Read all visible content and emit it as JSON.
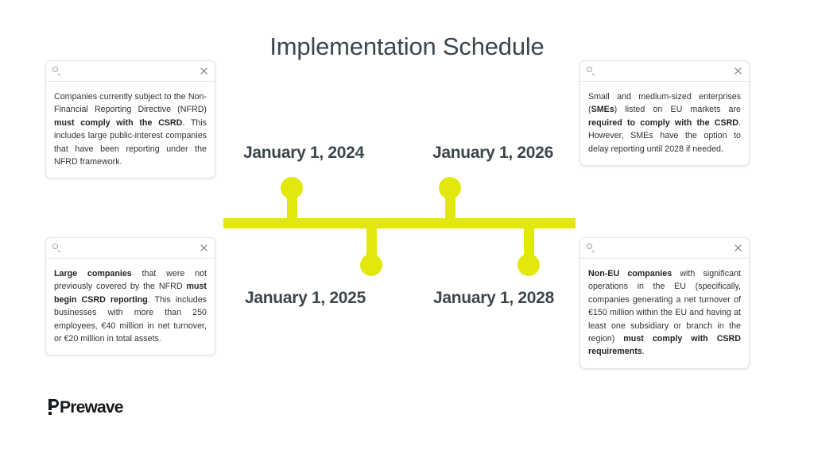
{
  "slide": {
    "title": "Implementation Schedule",
    "accent_color": "#e2e80c",
    "text_color": "#3d464c",
    "background": "#ffffff"
  },
  "timeline": {
    "milestones": [
      {
        "id": "m2024",
        "date": "January 1, 2024",
        "position": "above"
      },
      {
        "id": "m2025",
        "date": "January 1, 2025",
        "position": "below"
      },
      {
        "id": "m2026",
        "date": "January 1, 2026",
        "position": "above"
      },
      {
        "id": "m2028",
        "date": "January 1, 2028",
        "position": "below"
      }
    ]
  },
  "cards": {
    "top_left": {
      "search_icon": "search-icon",
      "close_icon": "close-icon",
      "text_parts": [
        {
          "text": "Companies currently subject to the Non-Financial Reporting Directive (NFRD) ",
          "bold": false
        },
        {
          "text": "must comply with the CSRD",
          "bold": true
        },
        {
          "text": ". This includes large public-interest companies that have been reporting under the NFRD framework.",
          "bold": false
        }
      ]
    },
    "top_right": {
      "search_icon": "search-icon",
      "close_icon": "close-icon",
      "text_parts": [
        {
          "text": "Small and medium-sized enterprises (",
          "bold": false
        },
        {
          "text": "SMEs",
          "bold": true
        },
        {
          "text": ") listed on EU markets are ",
          "bold": false
        },
        {
          "text": "required to comply with the CSRD",
          "bold": true
        },
        {
          "text": ". However, SMEs have the option to delay reporting until 2028 if needed.",
          "bold": false
        }
      ]
    },
    "bottom_left": {
      "search_icon": "search-icon",
      "close_icon": "close-icon",
      "text_parts": [
        {
          "text": "Large companies",
          "bold": true
        },
        {
          "text": " that were not previously covered by the NFRD ",
          "bold": false
        },
        {
          "text": "must begin CSRD reporting",
          "bold": true
        },
        {
          "text": ". This includes businesses with more than 250 employees, €40 million in net turnover, or €20 million in total assets.",
          "bold": false
        }
      ]
    },
    "bottom_right": {
      "search_icon": "search-icon",
      "close_icon": "close-icon",
      "text_parts": [
        {
          "text": "Non-EU companies",
          "bold": true
        },
        {
          "text": " with significant operations in the EU (specifically, companies generating a net turnover of €150 million within the EU and having at least one subsidiary or branch in the region) ",
          "bold": false
        },
        {
          "text": "must comply with CSRD requirements",
          "bold": true
        },
        {
          "text": ".",
          "bold": false
        }
      ]
    }
  },
  "logo": {
    "name": "Prewave",
    "color": "#15191c"
  }
}
